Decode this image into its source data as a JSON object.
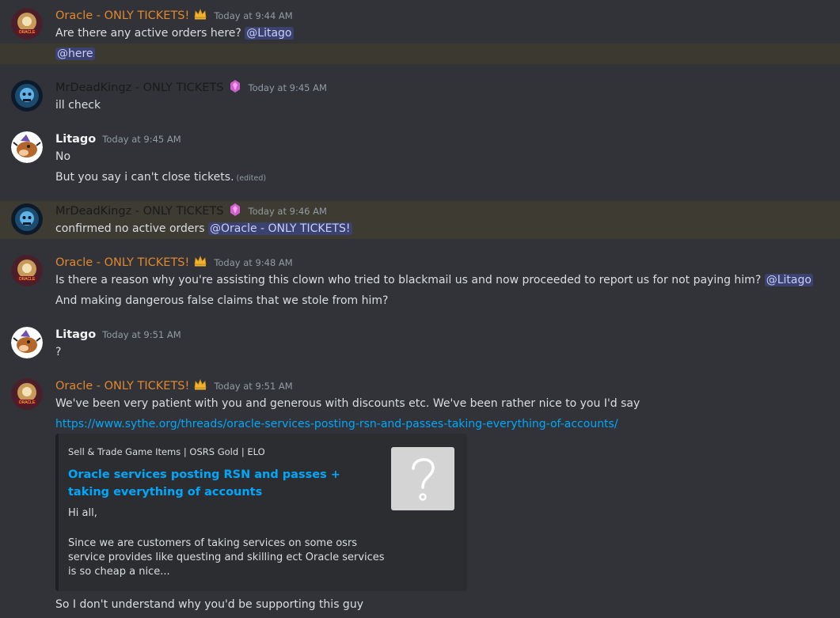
{
  "messages": {
    "m1": {
      "author": "Oracle - ONLY TICKETS!",
      "timestamp": "Today at 9:44 AM",
      "line1_text": "Are there any active orders here? ",
      "line1_mention": "@Litago",
      "line2_mention": "@here"
    },
    "m2": {
      "author": "MrDeadKingz - ONLY TICKETS",
      "timestamp": "Today at 9:45 AM",
      "line1_text": "ill check"
    },
    "m3": {
      "author": "Litago",
      "timestamp": "Today at 9:45 AM",
      "line1_text": "No",
      "line2_text": "But you say i can't close tickets.",
      "line2_edited": "(edited)"
    },
    "m4": {
      "author": "MrDeadKingz - ONLY TICKETS",
      "timestamp": "Today at 9:46 AM",
      "line1_text": "confirmed no active orders ",
      "line1_mention": "@Oracle - ONLY TICKETS!"
    },
    "m5": {
      "author": "Oracle - ONLY TICKETS!",
      "timestamp": "Today at 9:48 AM",
      "line1_text": "Is there a reason why you're assisting this clown who tried to blackmail us and now proceeded to report us for not paying him? ",
      "line1_mention": "@Litago",
      "line2_text": "And making dangerous false claims that we stole from him?"
    },
    "m6": {
      "author": "Litago",
      "timestamp": "Today at 9:51 AM",
      "line1_text": "?"
    },
    "m7": {
      "author": "Oracle - ONLY TICKETS!",
      "timestamp": "Today at 9:51 AM",
      "line1_text": "We've been very patient with you and generous with discounts etc. We've been rather nice to you I'd say",
      "link": "https://www.sythe.org/threads/oracle-services-posting-rsn-and-passes-taking-everything-of-accounts/",
      "embed": {
        "provider": "Sell & Trade Game Items | OSRS Gold | ELO",
        "title": "Oracle services posting RSN and passes + taking everything of accounts",
        "desc1": "Hi all,",
        "desc2": "Since we are customers of taking services on some osrs service provides like questing and skilling ect Oracle services is so cheap a nice..."
      },
      "line_after": "So I don't understand why you'd be supporting this guy"
    }
  },
  "colors": {
    "background": "#313338",
    "oracle_name": "#e0882e",
    "mention_bg": "#3c4270",
    "link": "#00a8fc",
    "highlight": "#3c3930"
  },
  "icons": [
    "crown-icon",
    "booster-gem-icon",
    "question-mark-icon"
  ]
}
